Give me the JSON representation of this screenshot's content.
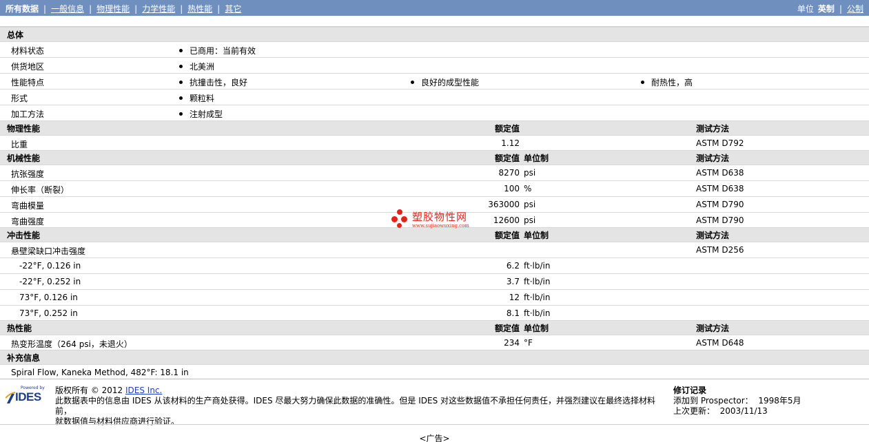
{
  "nav": {
    "tabs": [
      {
        "label": "所有数据",
        "active": true
      },
      {
        "label": "一般信息",
        "active": false
      },
      {
        "label": "物理性能",
        "active": false
      },
      {
        "label": "力学性能",
        "active": false
      },
      {
        "label": "热性能",
        "active": false
      },
      {
        "label": "其它",
        "active": false
      }
    ],
    "units_label": "单位",
    "units_current": "英制",
    "units_other": "公制"
  },
  "general": {
    "heading": "总体",
    "rows": [
      {
        "label": "材料状态",
        "items": [
          "已商用：当前有效"
        ]
      },
      {
        "label": "供货地区",
        "items": [
          "北美洲"
        ]
      },
      {
        "label": "性能特点",
        "items": [
          "抗撞击性，良好",
          "良好的成型性能",
          "耐热性，高"
        ]
      },
      {
        "label": "形式",
        "items": [
          "颗粒料"
        ]
      },
      {
        "label": "加工方法",
        "items": [
          "注射成型"
        ]
      }
    ]
  },
  "physical": {
    "heading": "物理性能",
    "col_value": "额定值",
    "col_method": "测试方法",
    "rows": [
      {
        "label": "比重",
        "value": "1.12",
        "unit": "",
        "method": "ASTM D792"
      }
    ]
  },
  "mechanical": {
    "heading": "机械性能",
    "col_value": "额定值",
    "col_unit": "单位制",
    "col_method": "测试方法",
    "rows": [
      {
        "label": "抗张强度",
        "value": "8270",
        "unit": "psi",
        "method": "ASTM D638"
      },
      {
        "label": "伸长率（断裂）",
        "value": "100",
        "unit": "%",
        "method": "ASTM D638"
      },
      {
        "label": "弯曲模量",
        "value": "363000",
        "unit": "psi",
        "method": "ASTM D790"
      },
      {
        "label": "弯曲强度",
        "value": "12600",
        "unit": "psi",
        "method": "ASTM D790"
      }
    ]
  },
  "impact": {
    "heading": "冲击性能",
    "col_value": "额定值",
    "col_unit": "单位制",
    "col_method": "测试方法",
    "group_label": "悬壁梁缺口冲击强度",
    "group_method": "ASTM D256",
    "rows": [
      {
        "label": "-22°F, 0.126 in",
        "value": "6.2",
        "unit": "ft·lb/in"
      },
      {
        "label": "-22°F, 0.252 in",
        "value": "3.7",
        "unit": "ft·lb/in"
      },
      {
        "label": "73°F, 0.126 in",
        "value": "12",
        "unit": "ft·lb/in"
      },
      {
        "label": "73°F, 0.252 in",
        "value": "8.1",
        "unit": "ft·lb/in"
      }
    ]
  },
  "thermal": {
    "heading": "热性能",
    "col_value": "额定值",
    "col_unit": "单位制",
    "col_method": "测试方法",
    "rows": [
      {
        "label": "热变形温度（264 psi，未退火）",
        "value": "234",
        "unit": "°F",
        "method": "ASTM D648"
      }
    ]
  },
  "supplement": {
    "heading": "补充信息",
    "text": "Spiral Flow, Kaneka Method, 482°F: 18.1 in"
  },
  "watermark": {
    "title": "塑胶物性网",
    "url": "www.sujiaowuxing.com"
  },
  "footer": {
    "logo_powered": "Powered by",
    "logo_text": "IDES",
    "copyright_prefix": "版权所有 © 2012 ",
    "copyright_link": "IDES Inc.",
    "disclaimer_1": "此数据表中的信息由 IDES 从该材料的生产商处获得。IDES 尽最大努力确保此数据的准确性。但是 IDES 对这些数据值不承担任何责任，并强烈建议在最终选择材料前，",
    "disclaimer_2": "就数据值与材料供应商进行验证。",
    "rev_title": "修订记录",
    "rev_added_label": "添加到 Prospector：",
    "rev_added_value": "1998年5月",
    "rev_updated_label": "上次更新：",
    "rev_updated_value": "2003/11/13",
    "ad": "<广告>"
  },
  "colors": {
    "topbar": "#6f8fbf",
    "section_bg": "#e4e4e4",
    "watermark": "#e2231a",
    "link": "#1f3ec4"
  }
}
